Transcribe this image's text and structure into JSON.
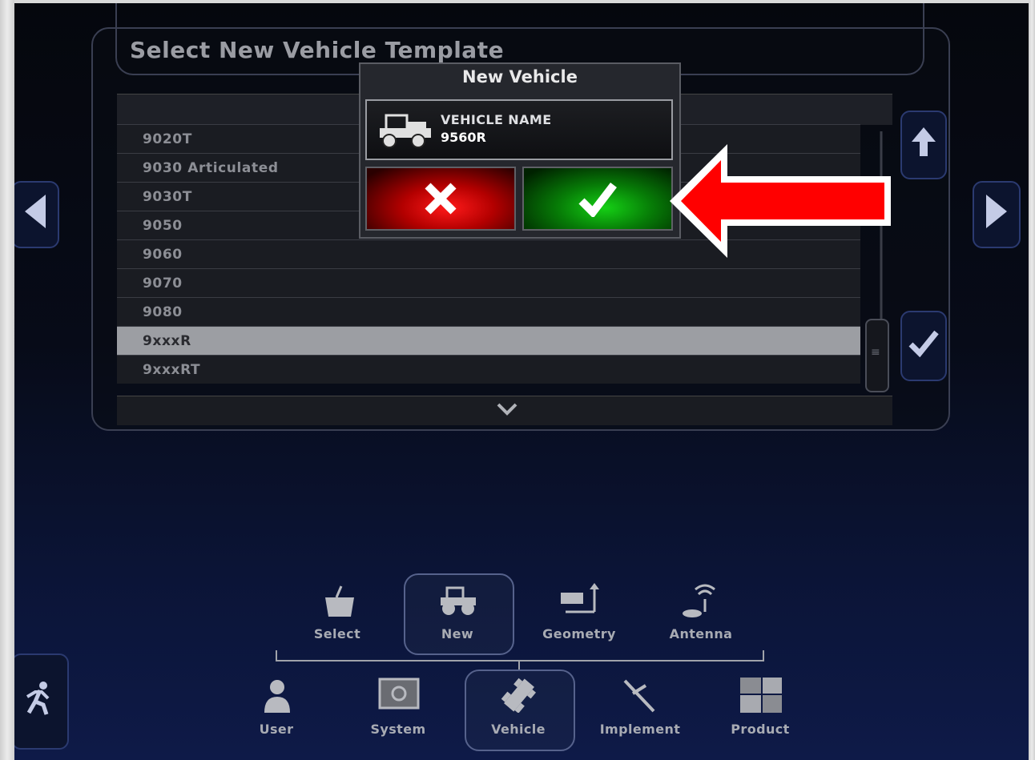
{
  "screen": {
    "title": "Select New Vehicle Template"
  },
  "list": {
    "items": [
      "9020T",
      "9030 Articulated",
      "9030T",
      "9050",
      "9060",
      "9070",
      "9080",
      "9xxxR",
      "9xxxRT"
    ],
    "selected_index": 7
  },
  "modal": {
    "title": "New Vehicle",
    "field_label": "VEHICLE NAME",
    "field_value": "9560R",
    "cancel_icon": "x-icon",
    "confirm_icon": "check-icon"
  },
  "side": {
    "left_icon": "arrow-left-icon",
    "right_icon": "arrow-right-icon",
    "up_icon": "arrow-up-icon",
    "confirm_icon": "check-icon",
    "exit_icon": "running-man-icon"
  },
  "subnav": [
    {
      "label": "Select",
      "icon": "select-icon"
    },
    {
      "label": "New",
      "icon": "new-vehicle-icon"
    },
    {
      "label": "Geometry",
      "icon": "geometry-icon"
    },
    {
      "label": "Antenna",
      "icon": "antenna-icon"
    }
  ],
  "mainnav": [
    {
      "label": "User",
      "icon": "user-icon"
    },
    {
      "label": "System",
      "icon": "system-icon"
    },
    {
      "label": "Vehicle",
      "icon": "vehicle-icon"
    },
    {
      "label": "Implement",
      "icon": "implement-icon"
    },
    {
      "label": "Product",
      "icon": "product-icon"
    }
  ],
  "colors": {
    "accent_arrow": "#ff0000",
    "confirm": "#0a9a0a",
    "cancel": "#cc0000",
    "selected_row": "#9c9ea3"
  }
}
